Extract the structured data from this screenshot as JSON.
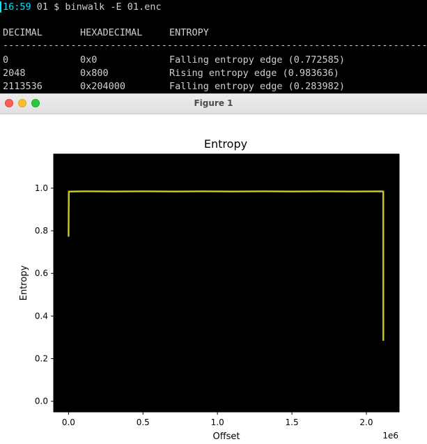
{
  "terminal": {
    "prompt_time": "16:59",
    "prompt_rest": " 01 $ binwalk -E 01.enc",
    "headers": [
      "DECIMAL",
      "HEXADECIMAL",
      "ENTROPY"
    ],
    "divider": "--------------------------------------------------------------------------------------------",
    "rows": [
      {
        "decimal": "0",
        "hex": "0x0",
        "entropy": "Falling entropy edge (0.772585)"
      },
      {
        "decimal": "2048",
        "hex": "0x800",
        "entropy": "Rising entropy edge (0.983636)"
      },
      {
        "decimal": "2113536",
        "hex": "0x204000",
        "entropy": "Falling entropy edge (0.283982)"
      }
    ]
  },
  "window": {
    "title": "Figure 1"
  },
  "chart_data": {
    "type": "line",
    "title": "Entropy",
    "xlabel": "Offset",
    "ylabel": "Entropy",
    "x_scale_label": "1e6",
    "xlim": [
      -0.1,
      2.22
    ],
    "ylim": [
      -0.05,
      1.16
    ],
    "x_ticks": [
      0.0,
      0.5,
      1.0,
      1.5,
      2.0
    ],
    "x_tick_labels": [
      "0.0",
      "0.5",
      "1.0",
      "1.5",
      "2.0"
    ],
    "y_ticks": [
      0.0,
      0.2,
      0.4,
      0.6,
      0.8,
      1.0
    ],
    "y_tick_labels": [
      "0.0",
      "0.2",
      "0.4",
      "0.6",
      "0.8",
      "1.0"
    ],
    "background": "#000000",
    "line_color": "#c8c51a",
    "grid": false,
    "series": [
      {
        "x": [
          0.0,
          0.002,
          0.1,
          0.3,
          0.5,
          0.7,
          0.9,
          1.1,
          1.3,
          1.5,
          1.7,
          1.9,
          2.1,
          2.1135,
          2.1136
        ],
        "y": [
          0.772585,
          0.983636,
          0.985,
          0.984,
          0.985,
          0.984,
          0.985,
          0.984,
          0.985,
          0.984,
          0.985,
          0.984,
          0.985,
          0.984,
          0.283982
        ]
      }
    ]
  }
}
